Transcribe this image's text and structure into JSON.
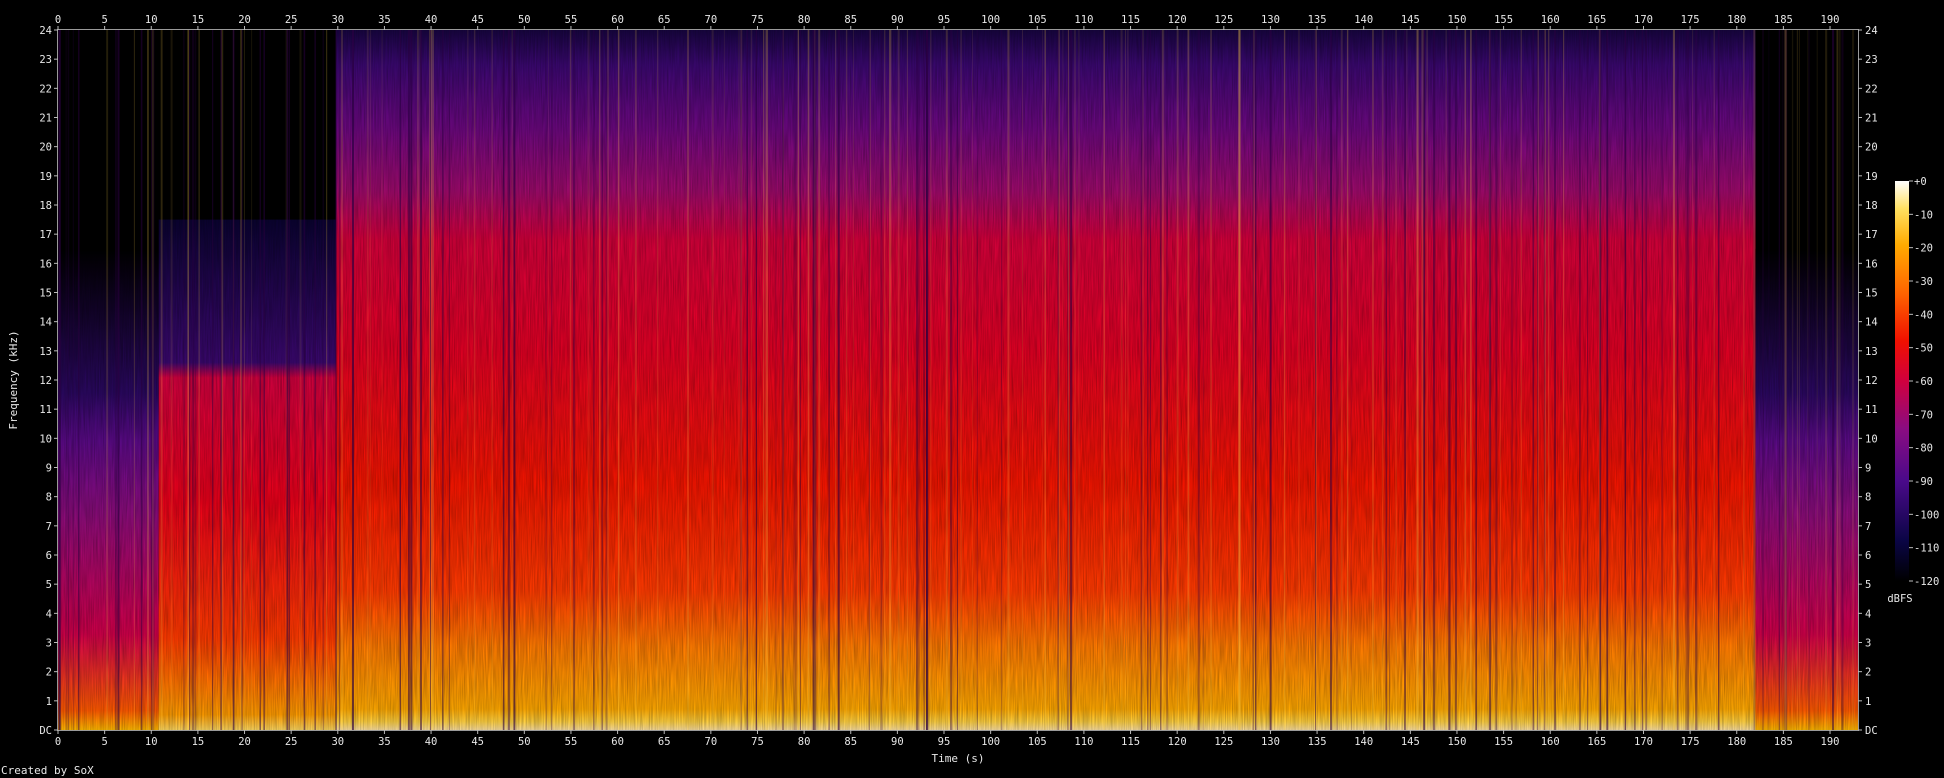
{
  "chart_data": {
    "type": "heatmap",
    "xlabel": "Time (s)",
    "ylabel": "Frequency (kHz)",
    "xlim": [
      0,
      193
    ],
    "ylim": [
      0,
      24
    ],
    "x_ticks": [
      "0",
      "5",
      "10",
      "15",
      "20",
      "25",
      "30",
      "35",
      "40",
      "45",
      "50",
      "55",
      "60",
      "65",
      "70",
      "75",
      "80",
      "85",
      "90",
      "95",
      "100",
      "105",
      "110",
      "115",
      "120",
      "125",
      "130",
      "135",
      "140",
      "145",
      "150",
      "155",
      "160",
      "165",
      "170",
      "175",
      "180",
      "185",
      "190"
    ],
    "y_ticks": [
      "DC",
      "1",
      "2",
      "3",
      "4",
      "5",
      "6",
      "7",
      "8",
      "9",
      "10",
      "11",
      "12",
      "13",
      "14",
      "15",
      "16",
      "17",
      "18",
      "19",
      "20",
      "21",
      "22",
      "23",
      "24"
    ],
    "colorbar": {
      "label": "dBFS",
      "ticks": [
        "+0",
        "-10",
        "-20",
        "-30",
        "-40",
        "-50",
        "-60",
        "-70",
        "-80",
        "-90",
        "-100",
        "-110",
        "-120"
      ],
      "range_db": [
        -120,
        0
      ]
    },
    "segments": [
      {
        "t_start": 0,
        "t_end": 10.8,
        "upper_khz": 16.5,
        "level": "low"
      },
      {
        "t_start": 10.8,
        "t_end": 29.8,
        "upper_khz": 17.5,
        "level": "mid"
      },
      {
        "t_start": 29.8,
        "t_end": 182,
        "upper_khz": 24,
        "level": "high"
      },
      {
        "t_start": 182,
        "t_end": 193,
        "upper_khz": 16.5,
        "level": "low"
      }
    ]
  },
  "footer": {
    "credit": "Created by SoX"
  }
}
